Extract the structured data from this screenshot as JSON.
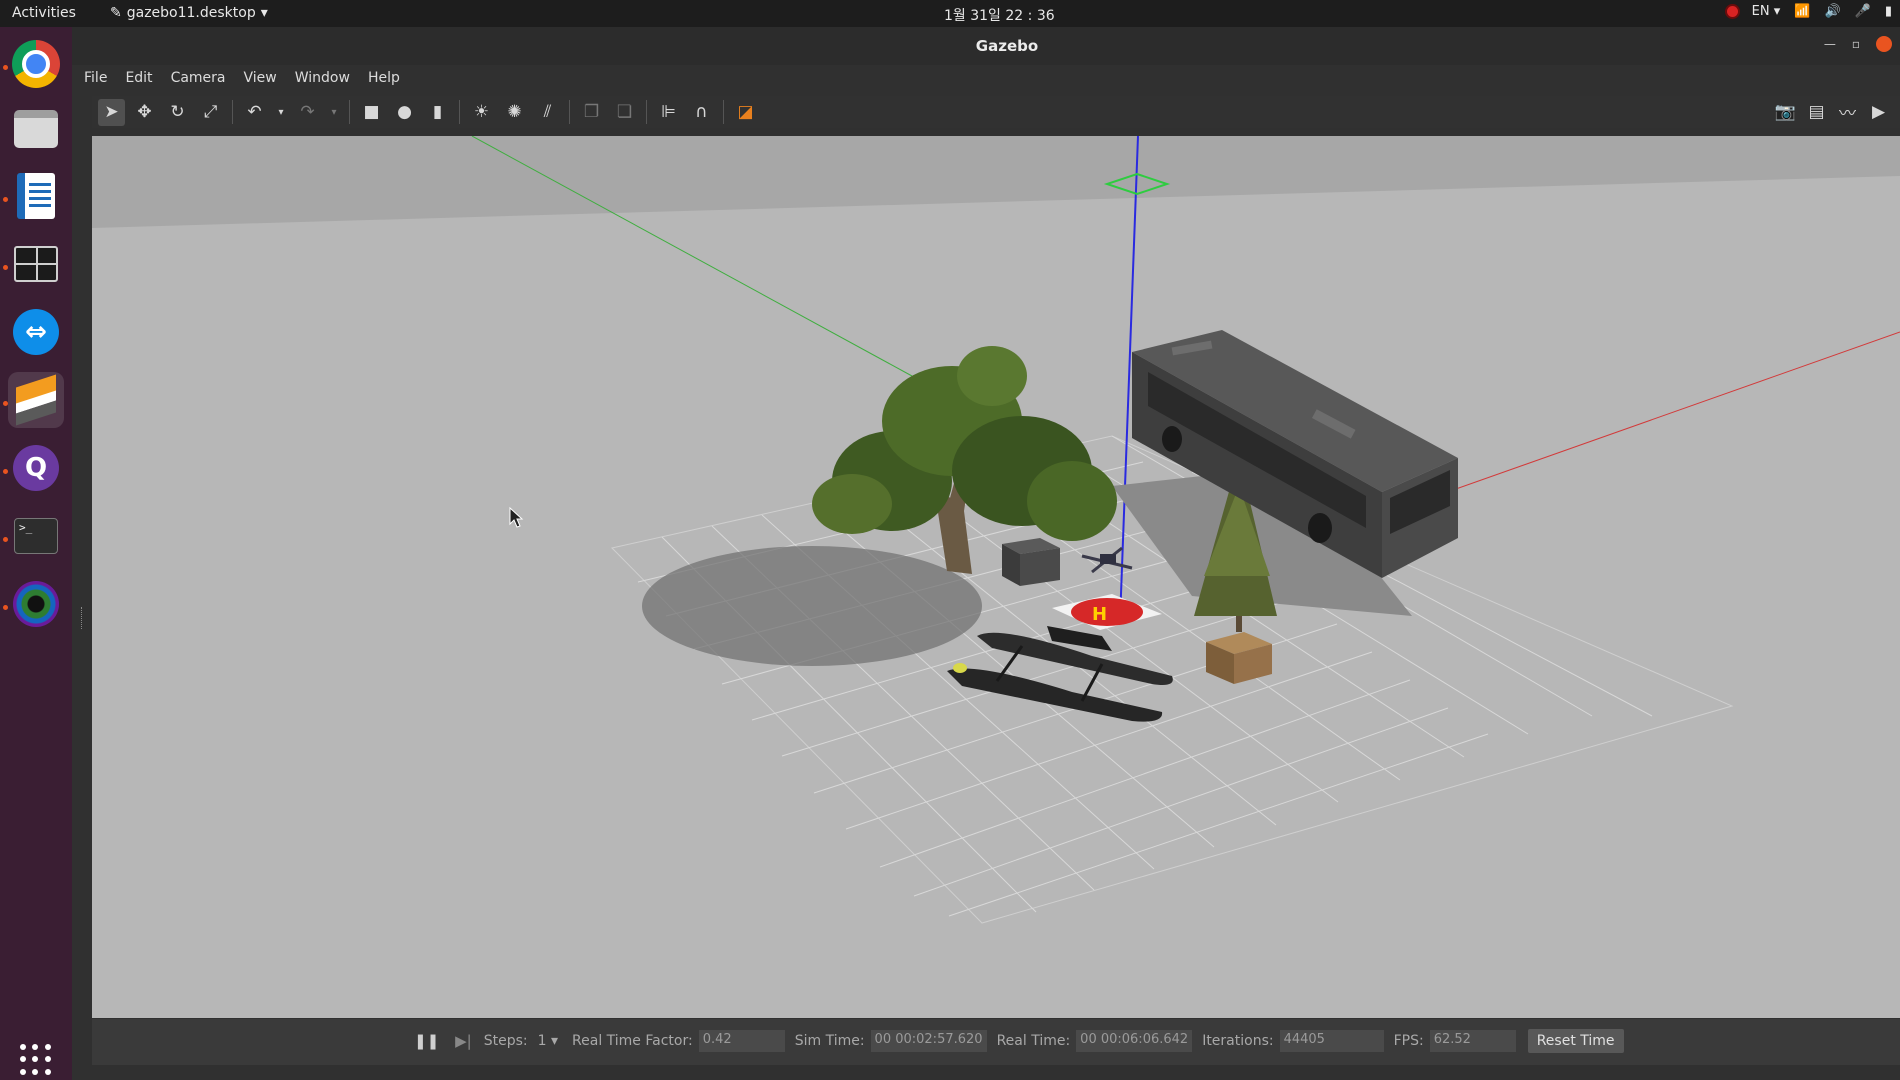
{
  "topbar": {
    "activities": "Activities",
    "app_menu": "gazebo11.desktop",
    "clock": "1월 31일 22 : 36",
    "lang": "EN"
  },
  "dock": {
    "items": [
      "chrome",
      "files",
      "libreoffice-writer",
      "terminator",
      "teamviewer",
      "gazebo",
      "qgroundcontrol",
      "terminal",
      "camera-lens"
    ],
    "terminal_prompt": ">_"
  },
  "window": {
    "title": "Gazebo"
  },
  "menu": [
    "File",
    "Edit",
    "Camera",
    "View",
    "Window",
    "Help"
  ],
  "status": {
    "steps_label": "Steps:",
    "steps_value": "1",
    "rtf_label": "Real Time Factor:",
    "rtf_value": "0.42",
    "sim_label": "Sim Time:",
    "sim_value": "00 00:02:57.620",
    "real_label": "Real Time:",
    "real_value": "00 00:06:06.642",
    "iter_label": "Iterations:",
    "iter_value": "44405",
    "fps_label": "FPS:",
    "fps_value": "62.52",
    "reset_label": "Reset Time"
  },
  "colors": {
    "ground": "#b7b7b7",
    "dock": "#3a1e33",
    "accent": "#e95420",
    "helipad": "#d62828"
  }
}
